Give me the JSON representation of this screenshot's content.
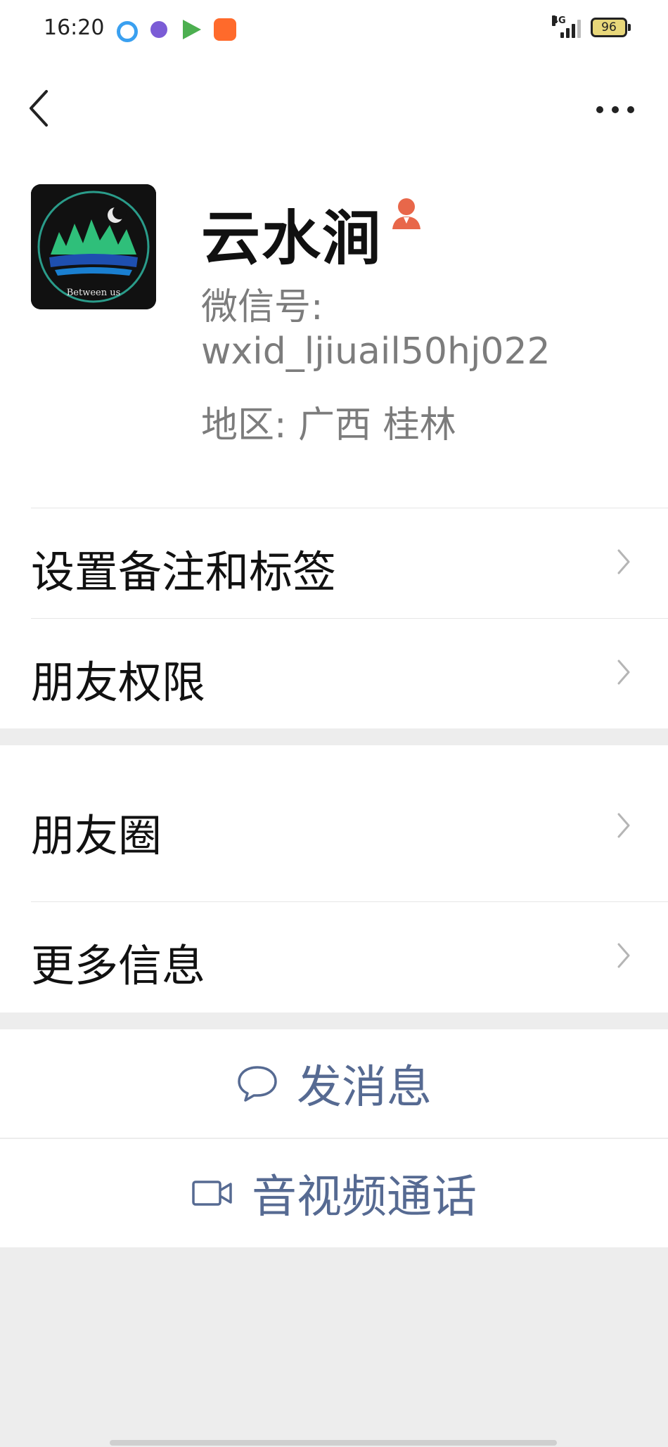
{
  "status_bar": {
    "time": "16:20",
    "network": "4G",
    "battery": "96",
    "apps": [
      {
        "icon": "browser-icon",
        "color": "#3aa0f0"
      },
      {
        "icon": "chat-bubble-app-icon",
        "color": "#7b5cd6"
      },
      {
        "icon": "video-play-app-icon",
        "color": "#4caf50"
      },
      {
        "icon": "kuaishou-app-icon",
        "color": "#ff6a2b"
      }
    ]
  },
  "profile": {
    "name": "云水涧",
    "wechat_id_label": "微信号:",
    "wechat_id": "wxid_ljiuail50hj022",
    "region": "地区:  广西  桂林",
    "avatar_text": "Between us"
  },
  "menu_group_1": [
    {
      "label": "设置备注和标签"
    },
    {
      "label": "朋友权限"
    }
  ],
  "menu_group_2": [
    {
      "label": "朋友圈"
    },
    {
      "label": "更多信息"
    }
  ],
  "actions": {
    "send_message": "发消息",
    "video_call": "音视频通话"
  },
  "colors": {
    "accent_link": "#566a92",
    "badge": "#e8674a",
    "background": "#ededed"
  }
}
